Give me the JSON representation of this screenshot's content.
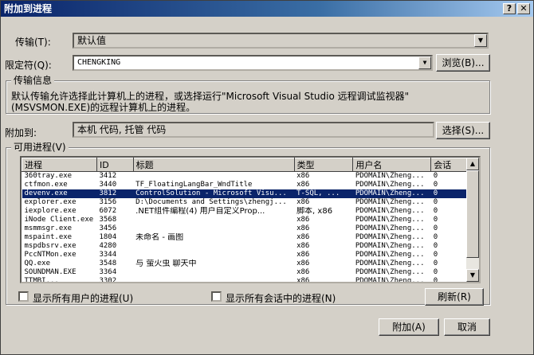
{
  "window": {
    "title": "附加到进程",
    "help": "?",
    "close": "✕"
  },
  "transport": {
    "label": "传输(T):",
    "value": "默认值"
  },
  "qualifier": {
    "label": "限定符(Q):",
    "value": "CHENGKING",
    "browse": "浏览(B)..."
  },
  "info": {
    "title": "传输信息",
    "text": "默认传输允许选择此计算机上的进程，或选择运行\"Microsoft Visual Studio 远程调试监视器\"(MSVSMON.EXE)的远程计算机上的进程。"
  },
  "attach_to": {
    "label": "附加到:",
    "value": "本机 代码, 托管 代码",
    "select": "选择(S)..."
  },
  "processes": {
    "title": "可用进程(V)",
    "columns": [
      "进程",
      "ID",
      "标题",
      "类型",
      "用户名",
      "会话"
    ],
    "rows": [
      [
        "360tray.exe",
        "3412",
        "",
        "x86",
        "PDOMAIN\\Zheng...",
        "0"
      ],
      [
        "ctfmon.exe",
        "3440",
        "TF_FloatingLangBar_WndTitle",
        "x86",
        "PDOMAIN\\Zheng...",
        "0"
      ],
      [
        "devenv.exe",
        "3812",
        "ControlSolution - Microsoft Visu...",
        "T-SQL, ...",
        "PDOMAIN\\Zheng...",
        "0"
      ],
      [
        "explorer.exe",
        "3156",
        "D:\\Documents and Settings\\zhengj...",
        "x86",
        "PDOMAIN\\Zheng...",
        "0"
      ],
      [
        "iexplore.exe",
        "6072",
        ".NET组件编程(4) 用户自定义Prop...",
        "脚本, x86",
        "PDOMAIN\\Zheng...",
        "0"
      ],
      [
        "iNode Client.exe",
        "3568",
        "",
        "x86",
        "PDOMAIN\\Zheng...",
        "0"
      ],
      [
        "msmmsgr.exe",
        "3456",
        "",
        "x86",
        "PDOMAIN\\Zheng...",
        "0"
      ],
      [
        "mspaint.exe",
        "1804",
        "未命名 - 画图",
        "x86",
        "PDOMAIN\\Zheng...",
        "0"
      ],
      [
        "mspdbsrv.exe",
        "4280",
        "",
        "x86",
        "PDOMAIN\\Zheng...",
        "0"
      ],
      [
        "PccNTMon.exe",
        "3344",
        "",
        "x86",
        "PDOMAIN\\Zheng...",
        "0"
      ],
      [
        "QQ.exe",
        "3548",
        "与 萤火虫 聊天中",
        "x86",
        "PDOMAIN\\Zheng...",
        "0"
      ],
      [
        "SOUNDMAN.EXE",
        "3364",
        "",
        "x86",
        "PDOMAIN\\Zheng...",
        "0"
      ],
      [
        "TTMBI...",
        "3302",
        "",
        "x86",
        "PDOMAIN\\Zheng...",
        "0"
      ]
    ],
    "selected_row": 2
  },
  "options": {
    "all_users": "显示所有用户的进程(U)",
    "all_sessions": "显示所有会话中的进程(N)",
    "refresh": "刷新(R)"
  },
  "footer": {
    "attach": "附加(A)",
    "cancel": "取消"
  },
  "colors": {
    "title_start": "#0a246a",
    "title_end": "#a6caf0",
    "selection": "#0a246a",
    "face": "#d4d0c8"
  }
}
